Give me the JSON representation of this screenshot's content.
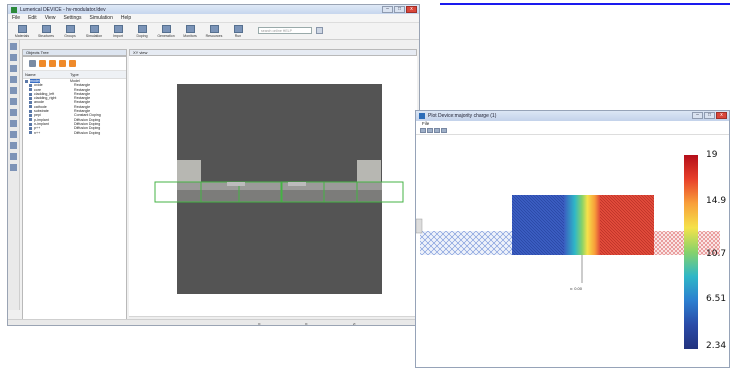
{
  "main_window": {
    "title": "Lumerical DEVICE - hv-modulator.ldev",
    "window_buttons": {
      "minimize": "–",
      "maximize": "□",
      "close": "x"
    },
    "menu": [
      "File",
      "Edit",
      "View",
      "Settings",
      "Simulation",
      "Help"
    ],
    "toolbar": [
      {
        "label": "Materials",
        "icon": "materials-icon"
      },
      {
        "label": "Structures",
        "icon": "structures-icon"
      },
      {
        "label": "Groups",
        "icon": "groups-icon"
      },
      {
        "label": "Simulation",
        "icon": "simulation-icon"
      },
      {
        "label": "Import",
        "icon": "import-icon"
      },
      {
        "label": "Doping",
        "icon": "doping-icon"
      },
      {
        "label": "Generation",
        "icon": "generation-icon"
      },
      {
        "label": "Monitors",
        "icon": "monitors-icon"
      },
      {
        "label": "Resources",
        "icon": "resources-icon"
      },
      {
        "label": "Run",
        "icon": "run-icon"
      }
    ],
    "search_placeholder": "search online HELP",
    "objects_panel": {
      "title": "Objects Tree",
      "columns": [
        "Name",
        "Type"
      ],
      "rows": [
        {
          "name": "model",
          "type": "Model",
          "indent": 0,
          "selected": true,
          "icon": "model-icon"
        },
        {
          "name": "oxide",
          "type": "Rectangle",
          "indent": 1,
          "icon": "rectangle-icon"
        },
        {
          "name": "core",
          "type": "Rectangle",
          "indent": 1,
          "icon": "rectangle-icon"
        },
        {
          "name": "cladding_left",
          "type": "Rectangle",
          "indent": 1,
          "icon": "rectangle-icon"
        },
        {
          "name": "cladding_right",
          "type": "Rectangle",
          "indent": 1,
          "icon": "rectangle-icon"
        },
        {
          "name": "anode",
          "type": "Rectangle",
          "indent": 1,
          "icon": "rectangle-icon"
        },
        {
          "name": "cathode",
          "type": "Rectangle",
          "indent": 1,
          "icon": "rectangle-icon"
        },
        {
          "name": "substrate",
          "type": "Rectangle",
          "indent": 1,
          "icon": "rectangle-icon"
        },
        {
          "name": "pepi",
          "type": "Constant Doping",
          "indent": 1,
          "icon": "doping-icon"
        },
        {
          "name": "p-implant",
          "type": "Diffusion Doping",
          "indent": 1,
          "icon": "doping-icon"
        },
        {
          "name": "n-implant",
          "type": "Diffusion Doping",
          "indent": 1,
          "icon": "doping-icon"
        },
        {
          "name": "p++",
          "type": "Diffusion Doping",
          "indent": 1,
          "icon": "doping-icon"
        },
        {
          "name": "n++",
          "type": "Diffusion Doping",
          "indent": 1,
          "icon": "doping-icon"
        }
      ]
    },
    "view_title": "XY view",
    "status": {
      "x": "x:",
      "y": "y:",
      "z": "z:"
    }
  },
  "popup_window": {
    "title": "Plot Device:majority charge (1)",
    "menu": [
      "File"
    ],
    "window_buttons": {
      "minimize": "–",
      "maximize": "□",
      "close": "x"
    },
    "colorbar": {
      "ticks": [
        "19",
        "14.9",
        "10.7",
        "6.51",
        "2.34"
      ],
      "colors": [
        "#b40e1a",
        "#e8402a",
        "#f8a03a",
        "#f5e24a",
        "#86d26a",
        "#2fb7c7",
        "#2c7fd0",
        "#2a4ba8",
        "#22337e"
      ]
    },
    "annotation": "x: 0.00"
  },
  "colors": {
    "view_background": "#545454",
    "outline": "#44b344",
    "mesh_blue": "#2f55b8",
    "mesh_red": "#d8322a"
  }
}
